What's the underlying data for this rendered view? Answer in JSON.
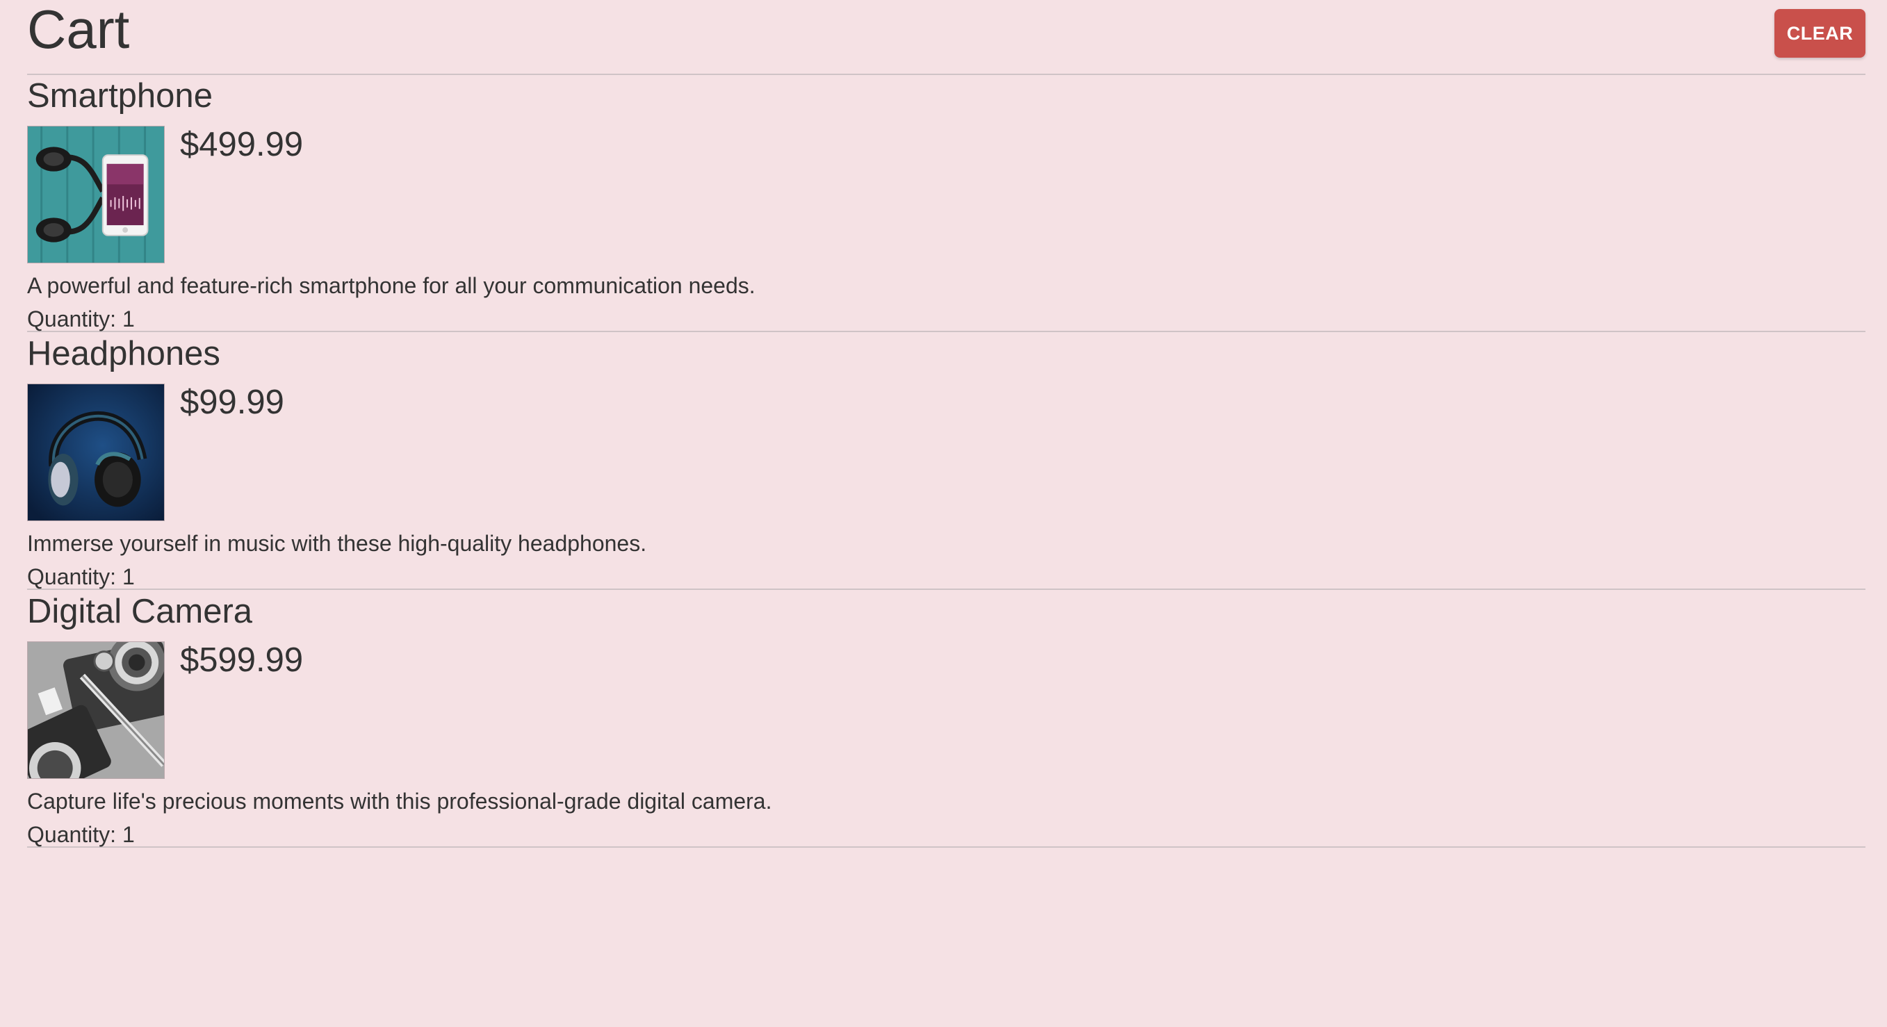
{
  "cart": {
    "title": "Cart",
    "clear_label": "CLEAR",
    "quantity_label": "Quantity:",
    "items": [
      {
        "name": "Smartphone",
        "price": "$499.99",
        "description": "A powerful and feature-rich smartphone for all your communication needs.",
        "quantity": "1",
        "image_icon": "smartphone-with-headphones-image"
      },
      {
        "name": "Headphones",
        "price": "$99.99",
        "description": "Immerse yourself in music with these high-quality headphones.",
        "quantity": "1",
        "image_icon": "headphones-image"
      },
      {
        "name": "Digital Camera",
        "price": "$599.99",
        "description": "Capture life's precious moments with this professional-grade digital camera.",
        "quantity": "1",
        "image_icon": "camera-image"
      }
    ]
  },
  "colors": {
    "background": "#f5e1e4",
    "text": "#333333",
    "clear_button": "#c9504b",
    "divider": "#cfc3c6"
  }
}
